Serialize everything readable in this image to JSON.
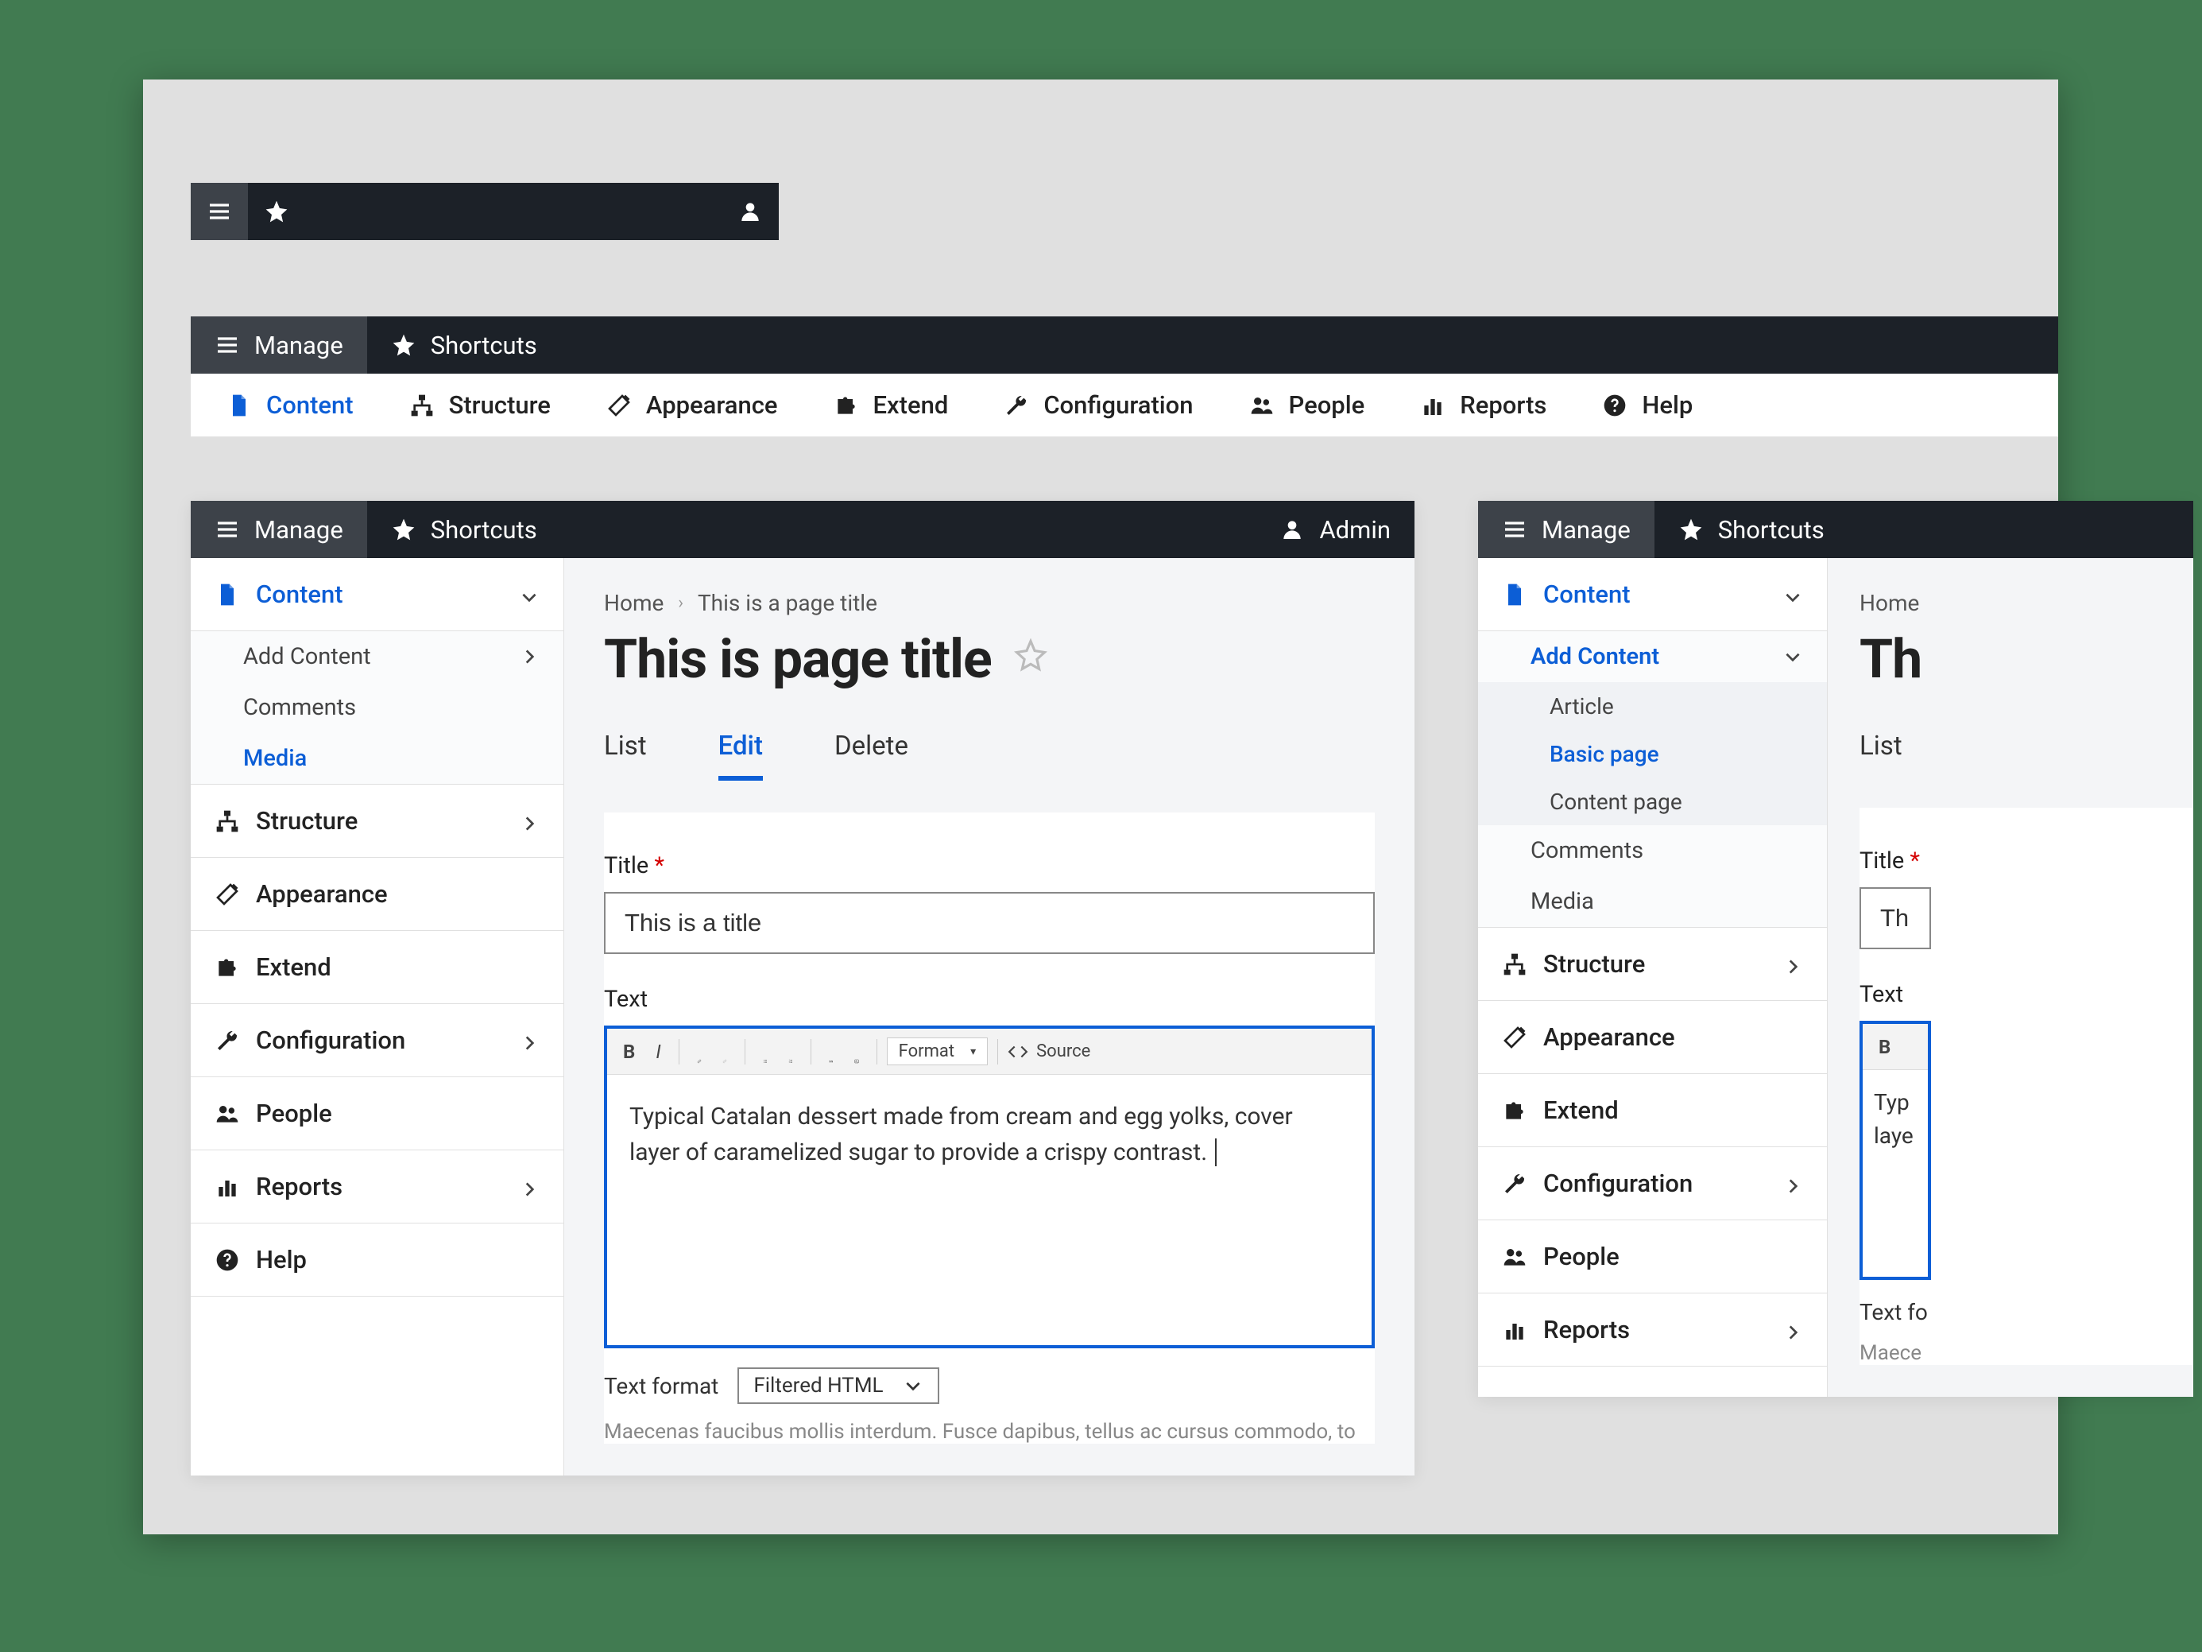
{
  "mini_toolbar": {},
  "hbar": {
    "manage": "Manage",
    "shortcuts": "Shortcuts",
    "items": [
      {
        "label": "Content",
        "icon": "file"
      },
      {
        "label": "Structure",
        "icon": "hierarchy"
      },
      {
        "label": "Appearance",
        "icon": "wand"
      },
      {
        "label": "Extend",
        "icon": "puzzle"
      },
      {
        "label": "Configuration",
        "icon": "wrench"
      },
      {
        "label": "People",
        "icon": "people"
      },
      {
        "label": "Reports",
        "icon": "bars"
      },
      {
        "label": "Help",
        "icon": "help"
      }
    ]
  },
  "panel_a": {
    "manage": "Manage",
    "shortcuts": "Shortcuts",
    "admin": "Admin",
    "sidebar": {
      "content": "Content",
      "sub": {
        "add_content": "Add Content",
        "comments": "Comments",
        "media": "Media"
      },
      "structure": "Structure",
      "appearance": "Appearance",
      "extend": "Extend",
      "configuration": "Configuration",
      "people": "People",
      "reports": "Reports",
      "help": "Help"
    },
    "breadcrumb": {
      "home": "Home",
      "current": "This is a page title"
    },
    "page_title": "This is page title",
    "tabs": {
      "list": "List",
      "edit": "Edit",
      "delete": "Delete"
    },
    "form": {
      "title_label": "Title",
      "title_value": "This is a title",
      "text_label": "Text",
      "toolbar": {
        "format": "Format",
        "source": "Source"
      },
      "body": "Typical Catalan dessert made from cream and egg yolks, cover",
      "body2": "layer of caramelized sugar to provide a crispy contrast.",
      "format_label": "Text format",
      "format_value": "Filtered HTML",
      "hint": "Maecenas faucibus mollis interdum. Fusce dapibus, tellus ac cursus commodo, to"
    }
  },
  "panel_b": {
    "manage": "Manage",
    "shortcuts": "Shortcuts",
    "sidebar": {
      "content": "Content",
      "add_content": "Add Content",
      "types": {
        "article": "Article",
        "basic_page": "Basic page",
        "content_page": "Content page"
      },
      "comments": "Comments",
      "media": "Media",
      "structure": "Structure",
      "appearance": "Appearance",
      "extend": "Extend",
      "configuration": "Configuration",
      "people": "People",
      "reports": "Reports"
    },
    "breadcrumb": {
      "home": "Home"
    },
    "page_title": "Th",
    "tabs": {
      "list": "List"
    },
    "form": {
      "title_label": "Title",
      "title_value": "This",
      "text_label": "Text",
      "bold": "B",
      "body": "Typ",
      "body2": "laye",
      "format_label": "Text fo",
      "hint": "Maece"
    }
  }
}
